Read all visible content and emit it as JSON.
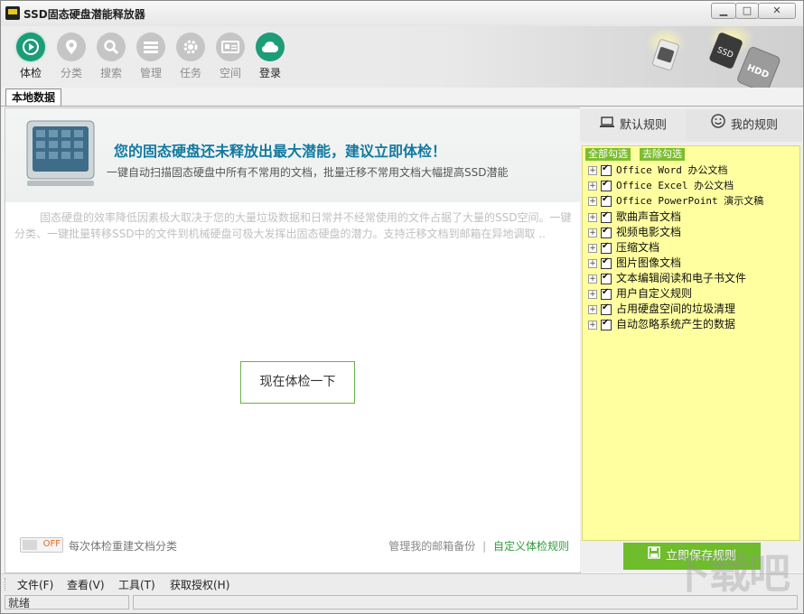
{
  "window": {
    "title": "SSD固态硬盘潜能释放器",
    "minimize_glyph": "▁",
    "maximize_glyph": "□",
    "close_glyph": "✕"
  },
  "toolbar": {
    "items": [
      {
        "label": "体检",
        "icon": "play-icon"
      },
      {
        "label": "分类",
        "icon": "location-pin-icon"
      },
      {
        "label": "搜索",
        "icon": "search-icon"
      },
      {
        "label": "管理",
        "icon": "list-icon"
      },
      {
        "label": "任务",
        "icon": "gear-icon"
      },
      {
        "label": "空间",
        "icon": "card-icon"
      },
      {
        "label": "登录",
        "icon": "cloud-icon"
      }
    ],
    "art_labels": {
      "ssd": "SSD",
      "hdd": "HDD"
    }
  },
  "tabs": [
    {
      "label": "本地数据"
    }
  ],
  "banner": {
    "title": "您的固态硬盘还未释放出最大潜能，建议立即体检！",
    "subtitle": "一键自动扫描固态硬盘中所有不常用的文档，批量迁移不常用文档大幅提高SSD潜能"
  },
  "description": "固态硬盘的效率降低因素极大取决于您的大量垃圾数据和日常并不经常使用的文件占据了大量的SSD空间。一键分类、一键批量转移SSD中的文件到机械硬盘可极大发挥出固态硬盘的潜力。支持迁移文档到邮箱在异地调取 ..",
  "check_button": "现在体检一下",
  "toggle": {
    "state": "OFF",
    "label": "每次体检重建文档分类"
  },
  "footer_links": {
    "mail_backup": "管理我的邮箱备份",
    "separator": "|",
    "custom_rules": "自定义体检规则"
  },
  "rules_panel": {
    "tab_default": "默认规则",
    "tab_mine": "我的规则",
    "select_all": "全部勾选",
    "deselect_all": "去除勾选",
    "rules": [
      {
        "label": "Office Word 办公文档",
        "checked": true
      },
      {
        "label": "Office Excel 办公文档",
        "checked": true
      },
      {
        "label": "Office PowerPoint 演示文稿",
        "checked": true
      },
      {
        "label": "歌曲声音文档",
        "checked": true
      },
      {
        "label": "视频电影文档",
        "checked": true
      },
      {
        "label": "压缩文档",
        "checked": true
      },
      {
        "label": "图片图像文档",
        "checked": true
      },
      {
        "label": "文本编辑阅读和电子书文件",
        "checked": true
      },
      {
        "label": "用户自定义规则",
        "checked": true
      },
      {
        "label": "占用硬盘空间的垃圾清理",
        "checked": true
      },
      {
        "label": "自动忽略系统产生的数据",
        "checked": true
      }
    ],
    "save_button": "立即保存规则"
  },
  "menubar": [
    "文件(F)",
    "查看(V)",
    "工具(T)",
    "获取授权(H)"
  ],
  "status": {
    "text": "就绪"
  },
  "watermark": "下载吧",
  "colors": {
    "accent_green": "#6fbc2c",
    "active_teal": "#1d9c78",
    "rule_bg": "#ffffa0",
    "title_blue": "#127aa0"
  }
}
